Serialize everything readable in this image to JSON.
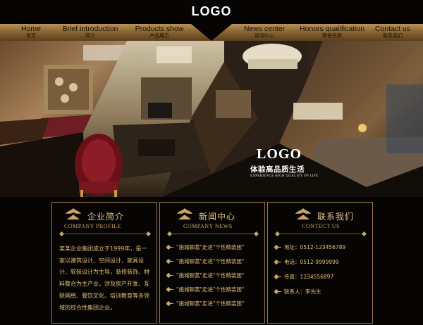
{
  "header": {
    "logo": "LOGO"
  },
  "nav": [
    {
      "en": "Home",
      "zh": "首页"
    },
    {
      "en": "Brief introduction",
      "zh": "简介"
    },
    {
      "en": "Products show",
      "zh": "产品展示"
    },
    {
      "en": "News center",
      "zh": "新闻中心"
    },
    {
      "en": "Honors qualification",
      "zh": "荣誉资质"
    },
    {
      "en": "Contact us",
      "zh": "联系我们"
    }
  ],
  "banner": {
    "logo": "LOGO",
    "slogan": "体验高品质生活",
    "sub": "EXPERIENCE HIGH QUALITY OF LIFE"
  },
  "about": {
    "title_zh": "企业简介",
    "title_en": "COMPANY PROFILE",
    "text": "某某企业集团成立于1999年，是一家以建筑设计、空间设计、家具设计、软装设计为主导，装修装饰、材料整合为主产业，涉及房产开发、互联网络、餐饮文化、培训教育等多领域的综合性集团企业。"
  },
  "news": {
    "title_zh": "新闻中心",
    "title_en": "COMPANY NEWS",
    "items": [
      "\"施城聊蒿\"走进\"个性精装团\"",
      "\"施城聊蒿\"走进\"个性精装团\"",
      "\"施城聊蒿\"走进\"个性精装团\"",
      "\"施城聊蒿\"走进\"个性精装团\"",
      "\"施城聊蒿\"走进\"个性精装团\""
    ]
  },
  "contact": {
    "title_zh": "联系我们",
    "title_en": "CONTECT US",
    "items": [
      "地址：0512-123456789",
      "电话：0512-9999999",
      "传真：1234556897",
      "联系人：李先生"
    ]
  },
  "colors": {
    "gold": "#e3bf78",
    "nav_top": "#b8925a",
    "nav_bottom": "#5b3f1c",
    "panel_border": "#9a7a45"
  }
}
